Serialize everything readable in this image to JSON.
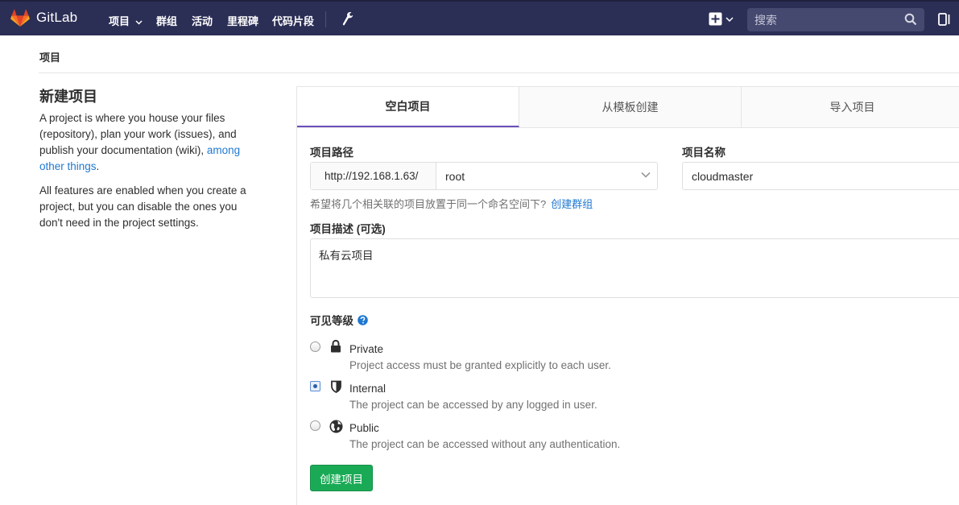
{
  "header": {
    "brand": "GitLab",
    "nav": [
      "项目",
      "群组",
      "活动",
      "里程碑",
      "代码片段"
    ],
    "search_placeholder": "搜索"
  },
  "breadcrumb": "项目",
  "sidebar": {
    "title": "新建项目",
    "intro_text": "A project is where you house your files (repository), plan your work (issues), and publish your documentation (wiki),",
    "intro_link": "among other things",
    "intro_end": ".",
    "features_text": "All features are enabled when you create a project, but you can disable the ones you don't need in the project settings."
  },
  "tabs": [
    "空白项目",
    "从模板创建",
    "导入项目"
  ],
  "form": {
    "path_label": "项目路径",
    "path_prefix": "http://192.168.1.63/",
    "namespace": "root",
    "name_label": "项目名称",
    "name_value": "cloudmaster",
    "hint_text": "希望将几个相关联的项目放置于同一个命名空间下?",
    "hint_link": "创建群组",
    "desc_label": "项目描述 (可选)",
    "desc_value": "私有云项目",
    "visibility_label": "可见等级",
    "visibility": [
      {
        "title": "Private",
        "desc": "Project access must be granted explicitly to each user.",
        "icon": "lock-icon",
        "checked": false
      },
      {
        "title": "Internal",
        "desc": "The project can be accessed by any logged in user.",
        "icon": "shield-icon",
        "checked": true
      },
      {
        "title": "Public",
        "desc": "The project can be accessed without any authentication.",
        "icon": "globe-icon",
        "checked": false
      }
    ],
    "submit_label": "创建项目"
  },
  "colors": {
    "nav_bg": "#2b2e55",
    "accent": "#6b4fbb",
    "link": "#1f78d1",
    "success": "#1aaa55"
  }
}
